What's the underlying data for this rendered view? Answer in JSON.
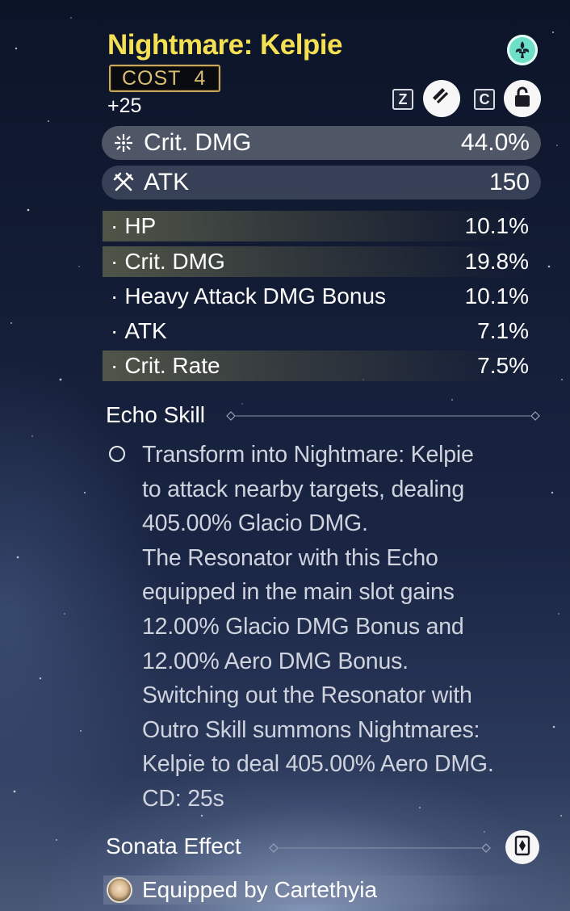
{
  "echo": {
    "name": "Nightmare: Kelpie",
    "cost_label": "COST",
    "cost_value": "4",
    "level": "+25",
    "set_icon": "fleur-de-lis-icon"
  },
  "controls": {
    "discard_key": "Z",
    "discard_icon": "discard-icon",
    "lock_key": "C",
    "lock_icon": "lock-icon"
  },
  "main_stats": [
    {
      "name": "Crit. DMG",
      "value": "44.0%",
      "icon": "crit-dmg-icon"
    },
    {
      "name": "ATK",
      "value": "150",
      "icon": "atk-swords-icon"
    }
  ],
  "sub_stats": [
    {
      "name": "HP",
      "value": "10.1%",
      "highlighted": true
    },
    {
      "name": "Crit. DMG",
      "value": "19.8%",
      "highlighted": true
    },
    {
      "name": "Heavy Attack DMG Bonus",
      "value": "10.1%",
      "highlighted": false
    },
    {
      "name": "ATK",
      "value": "7.1%",
      "highlighted": false
    },
    {
      "name": "Crit. Rate",
      "value": "7.5%",
      "highlighted": true
    }
  ],
  "sub_stat_bullet": "·",
  "echo_skill": {
    "heading": "Echo Skill",
    "text": "Transform into Nightmare: Kelpie\nto attack nearby targets, dealing\n405.00% Glacio DMG.\nThe Resonator with this Echo\nequipped in the main slot gains\n12.00% Glacio DMG Bonus and\n12.00% Aero DMG Bonus.\nSwitching out the Resonator with\nOutro Skill summons Nightmares:\nKelpie to deal 405.00% Aero DMG.\nCD: 25s"
  },
  "sonata": {
    "heading": "Sonata Effect",
    "icon": "sonata-card-icon"
  },
  "equipped": {
    "text": "Equipped by Cartethyia",
    "avatar": "character-avatar"
  },
  "colors": {
    "title": "#f4e052",
    "cost_border": "#c9a85c",
    "set_icon_bg": "#6ee0c8"
  }
}
